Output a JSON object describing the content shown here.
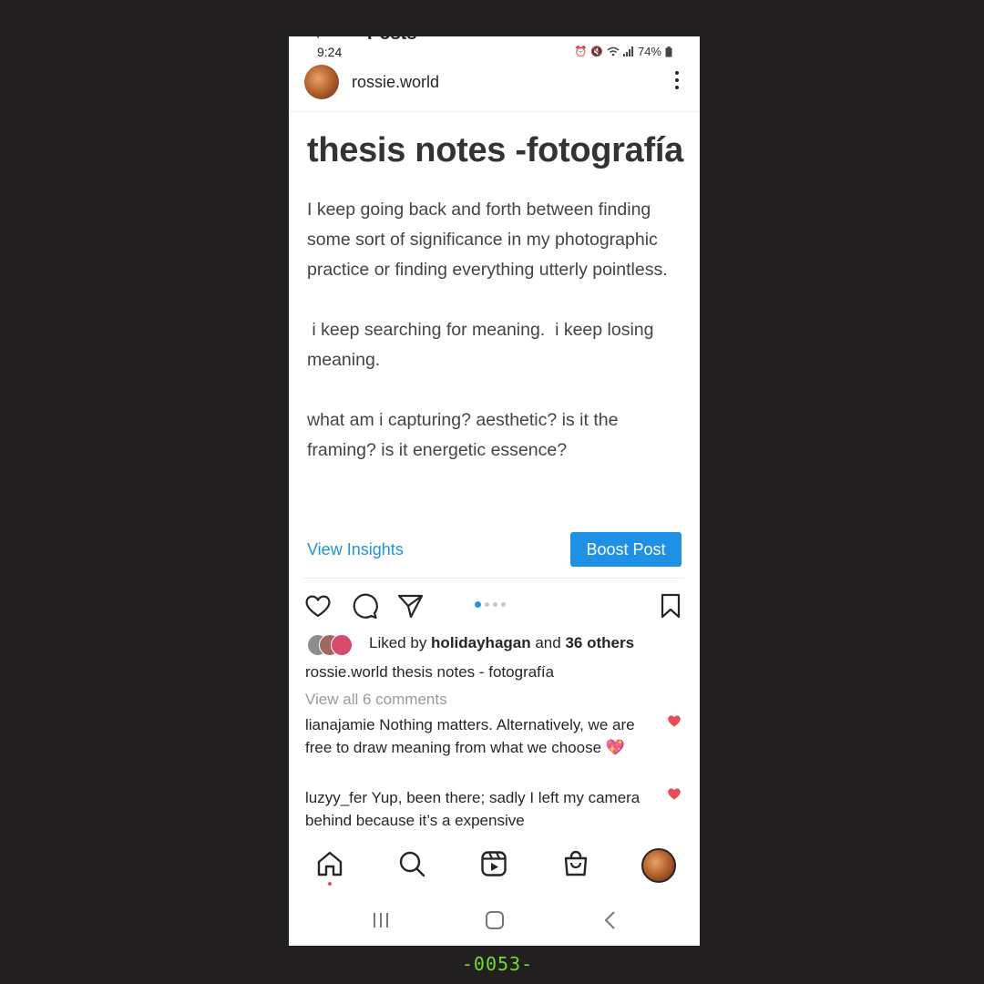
{
  "status_bar": {
    "time": "9:24",
    "battery": "74%"
  },
  "header_partial": "Posts",
  "post": {
    "username": "rossie.world",
    "title": "thesis notes -fotografía",
    "paragraphs": [
      "I keep going back and forth between finding some sort of significance in my photographic practice or finding everything utterly pointless.",
      " i keep searching for meaning.  i keep losing meaning.",
      "what am i capturing? aesthetic? is it the framing? is it energetic essence?"
    ],
    "carousel_active_index": 1,
    "carousel_count": 4
  },
  "actions": {
    "view_insights": "View Insights",
    "boost_post": "Boost Post"
  },
  "likes": {
    "prefix": "Liked by ",
    "user": "holidayhagan",
    "middle": " and ",
    "others": "36 others"
  },
  "caption": {
    "user": "rossie.world",
    "text": " thesis notes - fotografía"
  },
  "view_all_comments": "View all 6 comments",
  "comments": [
    {
      "user": "lianajamie",
      "text": " Nothing matters. Alternatively, we are free to draw meaning from what we choose",
      "emoji": "💖"
    },
    {
      "user": "luzyy_fer",
      "text": " Yup, been there; sadly I left my camera behind because it’s a expensive"
    }
  ],
  "frame_counter": "-0053-",
  "colors": {
    "accent_blue": "#1e90e6",
    "link_blue": "#2196d3",
    "like_red": "#ed4956",
    "background": "#221f20"
  }
}
